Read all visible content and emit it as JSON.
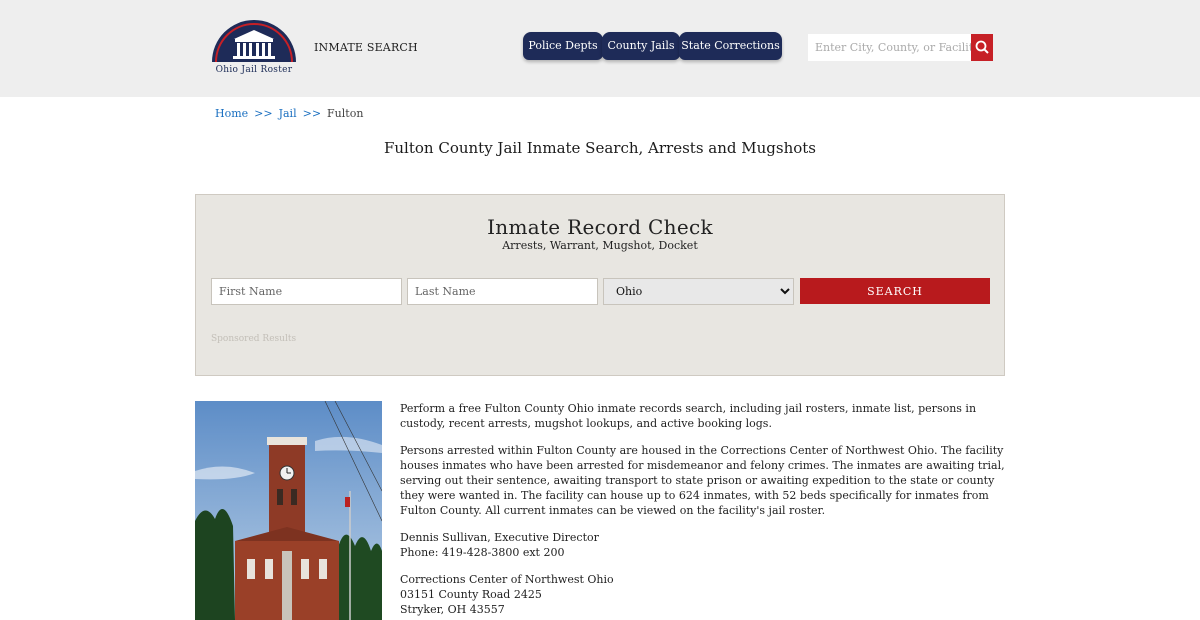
{
  "header": {
    "logo_text": "Ohio Jail Roster",
    "inmate_search_label": "INMATE SEARCH",
    "nav_tabs": [
      {
        "label": "Police Depts"
      },
      {
        "label": "County Jails"
      },
      {
        "label": "State Corrections"
      }
    ],
    "search_placeholder": "Enter City, County, or Facility",
    "brand_color": "#1e2b58",
    "accent_color": "#c62026"
  },
  "breadcrumb": {
    "home": "Home",
    "separator": ">>",
    "jail": "Jail",
    "current": "Fulton"
  },
  "page_title": "Fulton County Jail Inmate Search, Arrests and Mugshots",
  "record_check": {
    "title": "Inmate Record Check",
    "subtitle": "Arrests, Warrant, Mugshot, Docket",
    "first_name_placeholder": "First Name",
    "last_name_placeholder": "Last Name",
    "state_selected": "Ohio",
    "search_button": "SEARCH",
    "sponsored_label": "Sponsored Results"
  },
  "content": {
    "intro": "Perform a free Fulton County Ohio inmate records search, including jail rosters, inmate list, persons in custody, recent arrests, mugshot lookups, and active booking logs.",
    "details": "Persons arrested within Fulton County are housed in the Corrections Center of Northwest Ohio. The facility houses inmates who have been arrested for misdemeanor and felony crimes. The inmates are awaiting trial, serving out their sentence, awaiting transport to state prison or awaiting expedition to the state or county they were wanted in. The facility can house up to 624 inmates, with 52 beds specifically for inmates from Fulton County. All current inmates can be viewed on the facility's jail roster.",
    "contact_name": "Dennis Sullivan, Executive Director",
    "contact_phone": "Phone: 419-428-3800 ext 200",
    "facility_name": "Corrections Center of Northwest Ohio",
    "facility_address": "03151 County Road 2425",
    "facility_city": "Stryker, OH 43557"
  }
}
